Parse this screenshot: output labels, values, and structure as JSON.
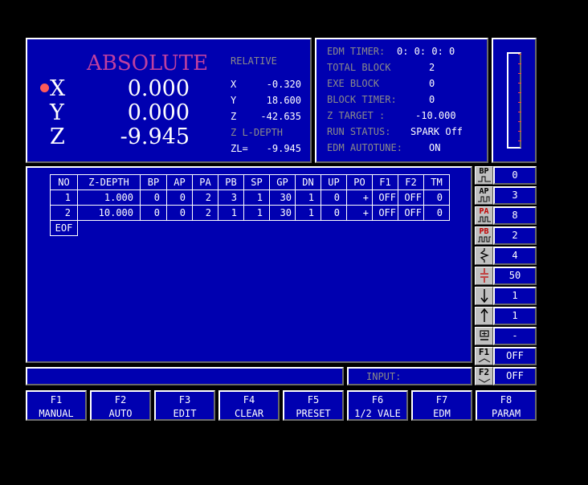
{
  "coords": {
    "absolute_label": "ABSOLUTE",
    "relative_label": "RELATIVE",
    "abs": [
      {
        "axis": "X",
        "value": "0.000"
      },
      {
        "axis": "Y",
        "value": "0.000"
      },
      {
        "axis": "Z",
        "value": "-9.945"
      }
    ],
    "rel": [
      {
        "axis": "X",
        "value": "-0.320"
      },
      {
        "axis": "Y",
        "value": "18.600"
      },
      {
        "axis": "Z",
        "value": "-42.635"
      }
    ],
    "zl_depth_label": "Z L-DEPTH",
    "zl_label": "ZL=",
    "zl_value": "-9.945",
    "active_marker_color": "#ff5a5a"
  },
  "status": {
    "edm_timer_label": "EDM TIMER:",
    "edm_timer_value": "0: 0: 0: 0",
    "total_block_label": "TOTAL BLOCK",
    "total_block_value": "2",
    "exe_block_label": "EXE BLOCK",
    "exe_block_value": "0",
    "block_timer_label": "BLOCK TIMER:",
    "block_timer_value": "0",
    "z_target_label": "Z TARGET  :",
    "z_target_value": "-10.000",
    "run_status_label": "RUN STATUS:",
    "run_status_value": "SPARK Off",
    "edm_autotune_label": "EDM AUTOTUNE:",
    "edm_autotune_value": "ON"
  },
  "table": {
    "headers": [
      "NO",
      "Z-DEPTH",
      "BP",
      "AP",
      "PA",
      "PB",
      "SP",
      "GP",
      "DN",
      "UP",
      "PO",
      "F1",
      "F2",
      "TM"
    ],
    "rows": [
      [
        "1",
        "1.000",
        "0",
        "0",
        "2",
        "3",
        "1",
        "30",
        "1",
        "0",
        "+",
        "OFF",
        "OFF",
        "0"
      ],
      [
        "2",
        "10.000",
        "0",
        "0",
        "2",
        "1",
        "1",
        "30",
        "1",
        "0",
        "+",
        "OFF",
        "OFF",
        "0"
      ]
    ],
    "eof_label": "EOF"
  },
  "side": [
    {
      "icon": "BP",
      "icon_name": "bp-pulse-icon",
      "value": "0"
    },
    {
      "icon": "AP",
      "icon_name": "ap-pulse-icon",
      "value": "3"
    },
    {
      "icon": "PA",
      "icon_name": "pa-pulse-icon",
      "value": "8"
    },
    {
      "icon": "PB",
      "icon_name": "pb-pulse-icon",
      "value": "2"
    },
    {
      "icon": "",
      "icon_name": "servo-zigzag-icon",
      "value": "4"
    },
    {
      "icon": "",
      "icon_name": "gap-icon",
      "value": "50"
    },
    {
      "icon": "",
      "icon_name": "down-arrow-icon",
      "value": "1"
    },
    {
      "icon": "",
      "icon_name": "up-arrow-icon",
      "value": "1"
    },
    {
      "icon": "",
      "icon_name": "polarity-icon",
      "value": "-"
    },
    {
      "icon": "F1",
      "icon_name": "f1-output-icon",
      "value": "OFF"
    },
    {
      "icon": "F2",
      "icon_name": "f2-output-icon",
      "value": "OFF"
    }
  ],
  "input_label": "INPUT:",
  "fkeys": [
    {
      "key": "F1",
      "label": "MANUAL"
    },
    {
      "key": "F2",
      "label": "AUTO"
    },
    {
      "key": "F3",
      "label": "EDIT"
    },
    {
      "key": "F4",
      "label": "CLEAR"
    },
    {
      "key": "F5",
      "label": "PRESET"
    },
    {
      "key": "F6",
      "label": "1/2 VALE"
    },
    {
      "key": "F7",
      "label": "EDM"
    },
    {
      "key": "F8",
      "label": "PARAM"
    }
  ],
  "colors": {
    "panel": "#0000b0",
    "absolute_title": "#c040a0",
    "dim_text": "#8a8a8a",
    "pa_icon": "#c00000"
  }
}
